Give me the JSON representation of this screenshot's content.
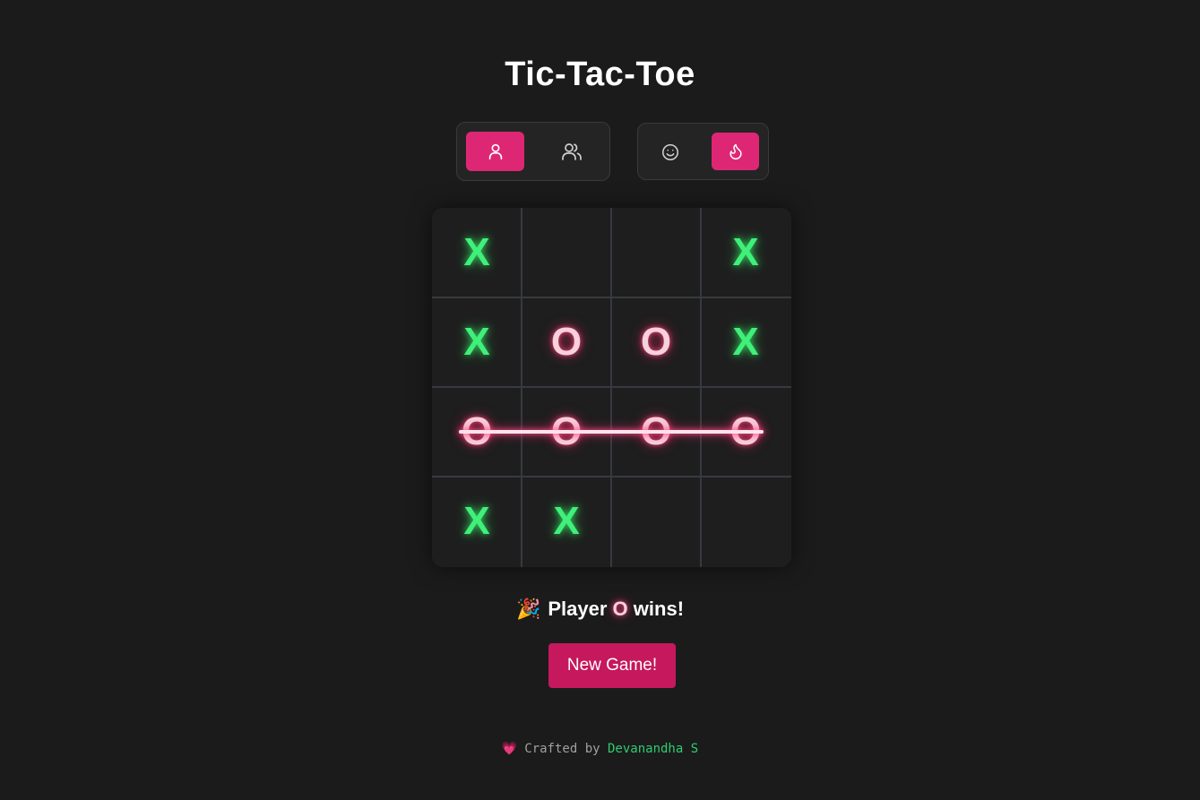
{
  "app": {
    "title": "Tic-Tac-Toe"
  },
  "mode_toggle": {
    "options": [
      {
        "icon": "single-player-icon",
        "selected": true
      },
      {
        "icon": "two-players-icon",
        "selected": false
      }
    ]
  },
  "difficulty_toggle": {
    "options": [
      {
        "icon": "smiley-easy-icon",
        "selected": false
      },
      {
        "icon": "flame-hard-icon",
        "selected": true
      }
    ]
  },
  "board": {
    "size": 4,
    "cells": [
      [
        "X",
        "",
        "",
        "X"
      ],
      [
        "X",
        "O",
        "O",
        "X"
      ],
      [
        "O",
        "O",
        "O",
        "O"
      ],
      [
        "X",
        "X",
        "",
        ""
      ]
    ],
    "winning_row": 2
  },
  "status": {
    "emoji": "🎉",
    "prefix": "Player",
    "winner": "O",
    "suffix": "wins!"
  },
  "new_game_button": {
    "label": "New Game!"
  },
  "footer": {
    "heart": "💗",
    "text": "Crafted by",
    "author": "Devanandha S"
  },
  "colors": {
    "background": "#1b1b1b",
    "accent": "#de2774",
    "button": "#c5185d",
    "x_mark": "#3ff07a",
    "o_mark": "#f7d1db",
    "author_link": "#2ecc71"
  }
}
